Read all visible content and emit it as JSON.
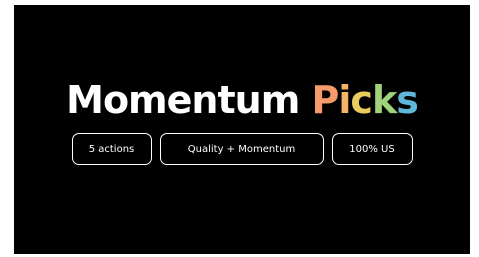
{
  "slide": {
    "title_main": "Momentum",
    "title_accent_letters": [
      "P",
      "i",
      "c",
      "k",
      "s"
    ],
    "title_accent_colors": [
      "#f59a6b",
      "#f5b36a",
      "#e8cd5e",
      "#9fd27a",
      "#5fb8d9"
    ],
    "tags": [
      "5 actions",
      "Quality + Momentum",
      "100% US"
    ]
  },
  "colors": {
    "background": "#000000",
    "text": "#ffffff"
  }
}
